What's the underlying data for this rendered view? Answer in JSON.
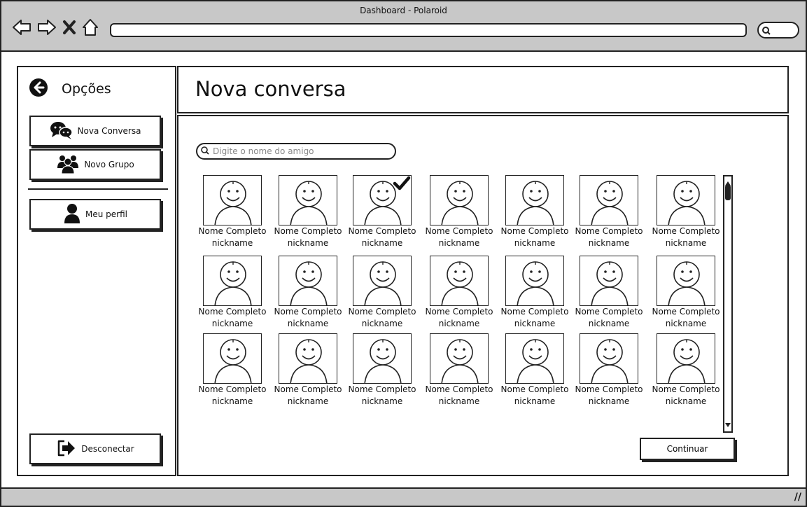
{
  "window": {
    "title": "Dashboard - Polaroid"
  },
  "sidebar": {
    "title": "Opções",
    "items": [
      {
        "label": "Nova Conversa",
        "icon": "chat-bubbles-icon"
      },
      {
        "label": "Novo Grupo",
        "icon": "group-icon"
      },
      {
        "label": "Meu perfil",
        "icon": "user-icon"
      }
    ],
    "logout_label": "Desconectar"
  },
  "header": {
    "title": "Nova conversa"
  },
  "search": {
    "placeholder": "Digite o nome do amigo"
  },
  "friends": [
    {
      "name": "Nome Completo",
      "nickname": "nickname",
      "selected": false
    },
    {
      "name": "Nome Completo",
      "nickname": "nickname",
      "selected": false
    },
    {
      "name": "Nome Completo",
      "nickname": "nickname",
      "selected": true
    },
    {
      "name": "Nome Completo",
      "nickname": "nickname",
      "selected": false
    },
    {
      "name": "Nome Completo",
      "nickname": "nickname",
      "selected": false
    },
    {
      "name": "Nome Completo",
      "nickname": "nickname",
      "selected": false
    },
    {
      "name": "Nome Completo",
      "nickname": "nickname",
      "selected": false
    },
    {
      "name": "Nome Completo",
      "nickname": "nickname",
      "selected": false
    },
    {
      "name": "Nome Completo",
      "nickname": "nickname",
      "selected": false
    },
    {
      "name": "Nome Completo",
      "nickname": "nickname",
      "selected": false
    },
    {
      "name": "Nome Completo",
      "nickname": "nickname",
      "selected": false
    },
    {
      "name": "Nome Completo",
      "nickname": "nickname",
      "selected": false
    },
    {
      "name": "Nome Completo",
      "nickname": "nickname",
      "selected": false
    },
    {
      "name": "Nome Completo",
      "nickname": "nickname",
      "selected": false
    },
    {
      "name": "Nome Completo",
      "nickname": "nickname",
      "selected": false
    },
    {
      "name": "Nome Completo",
      "nickname": "nickname",
      "selected": false
    },
    {
      "name": "Nome Completo",
      "nickname": "nickname",
      "selected": false
    },
    {
      "name": "Nome Completo",
      "nickname": "nickname",
      "selected": false
    },
    {
      "name": "Nome Completo",
      "nickname": "nickname",
      "selected": false
    },
    {
      "name": "Nome Completo",
      "nickname": "nickname",
      "selected": false
    },
    {
      "name": "Nome Completo",
      "nickname": "nickname",
      "selected": false
    }
  ],
  "actions": {
    "continue_label": "Continuar"
  }
}
